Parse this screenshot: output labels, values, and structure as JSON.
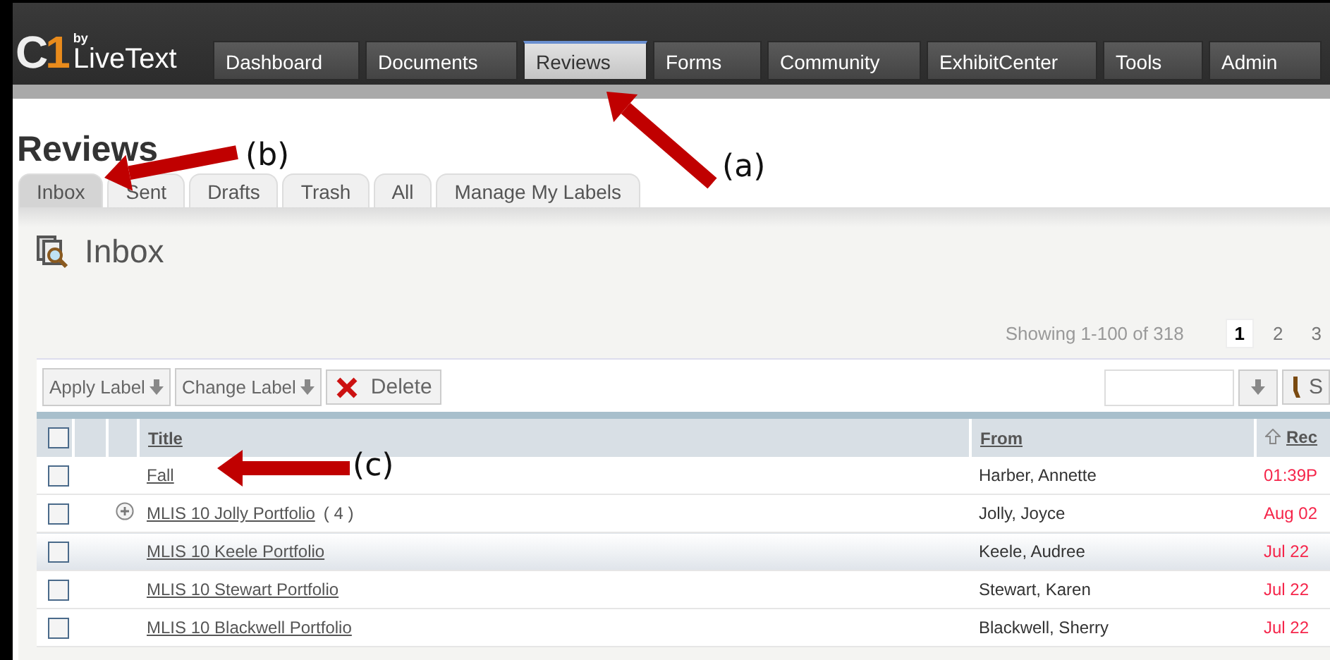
{
  "logo": {
    "mark": [
      "C",
      "1"
    ],
    "by": "by",
    "name": "LiveText"
  },
  "nav": [
    {
      "label": "Dashboard",
      "selected": false
    },
    {
      "label": "Documents",
      "selected": false
    },
    {
      "label": "Reviews",
      "selected": true
    },
    {
      "label": "Forms",
      "selected": false
    },
    {
      "label": "Community",
      "selected": false
    },
    {
      "label": "ExhibitCenter",
      "selected": false
    },
    {
      "label": "Tools",
      "selected": false
    },
    {
      "label": "Admin",
      "selected": false
    }
  ],
  "page_title": "Reviews",
  "tabs": [
    {
      "label": "Inbox",
      "selected": true
    },
    {
      "label": "Sent",
      "selected": false
    },
    {
      "label": "Drafts",
      "selected": false
    },
    {
      "label": "Trash",
      "selected": false
    },
    {
      "label": "All",
      "selected": false
    },
    {
      "label": "Manage My Labels",
      "selected": false
    }
  ],
  "panel_title": "Inbox",
  "paging": {
    "summary": "Showing 1-100 of 318",
    "pages": [
      {
        "label": "1",
        "selected": true
      },
      {
        "label": "2",
        "selected": false
      },
      {
        "label": "3",
        "selected": false
      }
    ]
  },
  "toolbar": {
    "buttons": [
      {
        "label": "Apply Label",
        "kind": "menu"
      },
      {
        "label": "Change Label",
        "kind": "menu"
      },
      {
        "label": "Delete",
        "kind": "delete"
      }
    ],
    "search_button": "S"
  },
  "table": {
    "select_all_checked": false,
    "columns": [
      "Title",
      "From",
      "Rec"
    ],
    "rows": [
      {
        "title": "Fall",
        "from": "Harber, Annette",
        "received": "01:39P",
        "checked": false,
        "selected": false
      },
      {
        "title": "MLIS 10 Jolly Portfolio",
        "count": "( 4 )",
        "from": "Jolly, Joyce",
        "received": "Aug 02",
        "checked": false,
        "selected": false
      },
      {
        "title": "MLIS 10 Keele Portfolio",
        "from": "Keele, Audree",
        "received": "Jul 22",
        "checked": false,
        "selected": true
      },
      {
        "title": "MLIS 10 Stewart Portfolio",
        "from": "Stewart, Karen",
        "received": "Jul 22",
        "checked": false,
        "selected": false
      },
      {
        "title": "MLIS 10 Blackwell Portfolio",
        "from": "Blackwell, Sherry",
        "received": "Jul 22",
        "checked": false,
        "selected": false
      }
    ]
  },
  "annotations": [
    {
      "label": "(a)",
      "kind": "a"
    },
    {
      "label": "(b)",
      "kind": "b"
    },
    {
      "label": "(c)",
      "kind": "c"
    }
  ]
}
